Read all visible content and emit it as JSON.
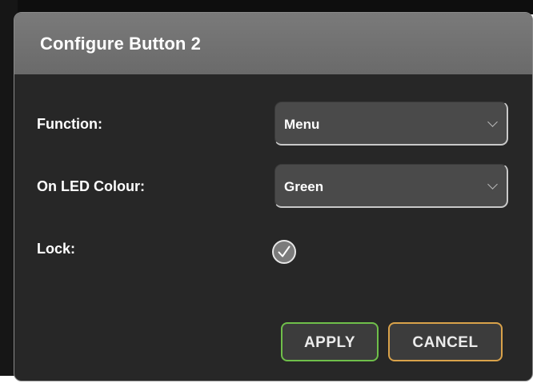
{
  "dialog": {
    "title": "Configure Button 2",
    "fields": {
      "function": {
        "label": "Function:",
        "value": "Menu"
      },
      "led_colour": {
        "label": "On LED Colour:",
        "value": "Green"
      },
      "lock": {
        "label": "Lock:",
        "checked": true
      }
    },
    "buttons": {
      "apply_label": "APPLY",
      "cancel_label": "CANCEL"
    }
  },
  "colors": {
    "dialog_background": "#272727",
    "header_background": "#707070",
    "apply_border": "#6fbf4a",
    "cancel_border": "#d9a24a"
  },
  "icons": {
    "select_chevron": "chevron-down-icon",
    "lock_check": "check-circle-icon"
  }
}
